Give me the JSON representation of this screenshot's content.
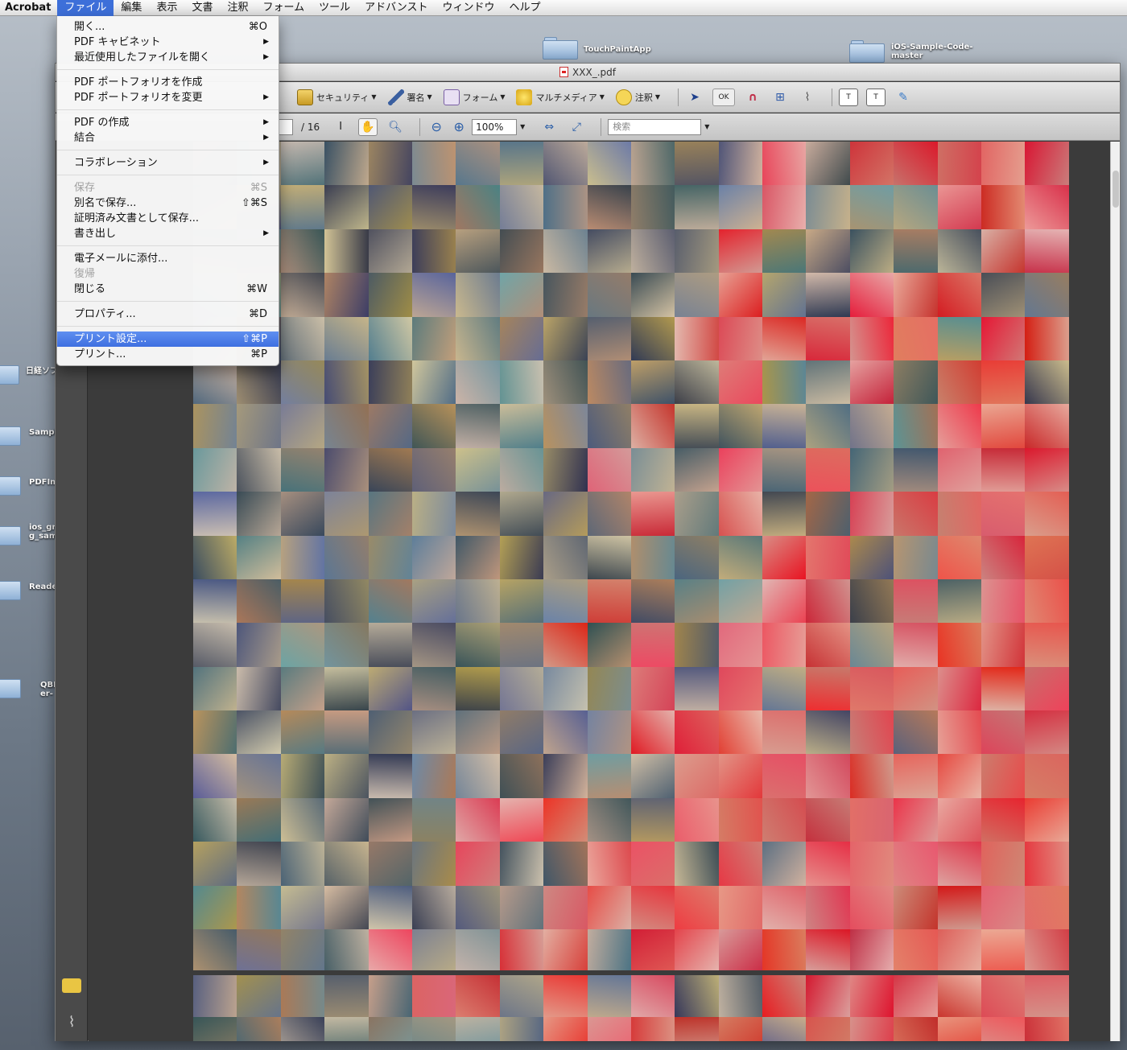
{
  "menubar": {
    "app": "Acrobat",
    "items": [
      "ファイル",
      "編集",
      "表示",
      "文書",
      "注釈",
      "フォーム",
      "ツール",
      "アドバンスト",
      "ウィンドウ",
      "ヘルプ"
    ]
  },
  "desktop": {
    "folders": [
      {
        "label": "TouchPaintApp"
      },
      {
        "label": "iOS-Sample-Code-master"
      },
      {
        "label": "日経ソフ"
      },
      {
        "label": "Sampl"
      },
      {
        "label": "PDFIm"
      },
      {
        "label": "ios_gr g_sam"
      },
      {
        "label": "Reade"
      },
      {
        "label": "QBI er-"
      }
    ]
  },
  "window": {
    "title": "XXX_.pdf",
    "toolbar1": {
      "security": "セキュリティ",
      "sign": "署名",
      "form": "フォーム",
      "multimedia": "マルチメディア",
      "comment": "注釈",
      "ok_label": "OK"
    },
    "toolbar2": {
      "page_total": "/ 16",
      "zoom": "100%",
      "search_placeholder": "検索"
    }
  },
  "file_menu": {
    "items": [
      {
        "label": "開く...",
        "shortcut": "⌘O"
      },
      {
        "label": "PDF キャビネット",
        "submenu": "▶"
      },
      {
        "label": "最近使用したファイルを開く",
        "submenu": "▶"
      },
      {
        "label": "PDF ポートフォリオを作成"
      },
      {
        "label": "PDF ポートフォリオを変更",
        "submenu": "▶"
      },
      {
        "label": "PDF の作成",
        "submenu": "▶"
      },
      {
        "label": "結合",
        "submenu": "▶"
      },
      {
        "label": "コラボレーション",
        "submenu": "▶"
      },
      {
        "label": "保存",
        "shortcut": "⌘S"
      },
      {
        "label": "別名で保存...",
        "shortcut": "⇧⌘S"
      },
      {
        "label": "証明済み文書として保存..."
      },
      {
        "label": "書き出し",
        "submenu": "▶"
      },
      {
        "label": "電子メールに添付..."
      },
      {
        "label": "復帰"
      },
      {
        "label": "閉じる",
        "shortcut": "⌘W"
      },
      {
        "label": "プロパティ...",
        "shortcut": "⌘D"
      },
      {
        "label": "プリント設定...",
        "shortcut": "⇧⌘P"
      },
      {
        "label": "プリント...",
        "shortcut": "⌘P"
      }
    ],
    "highlighted": "プリント設定..."
  },
  "colors": {
    "menu_highlight": "#3e6fe0",
    "mosaic_cool": "#4f5a63",
    "mosaic_red": "#d9323f"
  }
}
